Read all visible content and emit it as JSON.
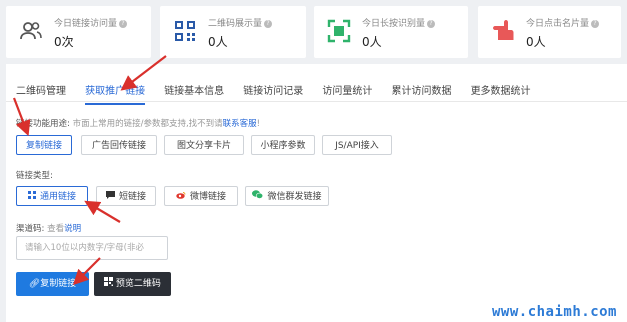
{
  "stats": [
    {
      "label": "今日链接访问量",
      "value": "0次",
      "icon": "users-icon",
      "color": "#555"
    },
    {
      "label": "二维码展示量",
      "value": "0人",
      "icon": "qrcode-icon",
      "color": "#2a5aa8"
    },
    {
      "label": "今日长按识别量",
      "value": "0人",
      "icon": "scan-icon",
      "color": "#2fb36b"
    },
    {
      "label": "今日点击名片量",
      "value": "0人",
      "icon": "hand-icon",
      "color": "#e85858"
    }
  ],
  "tabs": [
    "二维码管理",
    "获取推广链接",
    "链接基本信息",
    "链接访问记录",
    "访问量统计",
    "累计访问数据",
    "更多数据统计"
  ],
  "usage": {
    "label": "链接功能用途:",
    "hint": "市面上常用的链接/参数都支持,找不到请",
    "link": "联系客服",
    "tail": "!",
    "buttons": [
      "复制链接",
      "广告回传链接",
      "图文分享卡片",
      "小程序参数",
      "JS/API接入"
    ]
  },
  "type": {
    "label": "链接类型:",
    "buttons": [
      "通用链接",
      "短链接",
      "微博链接",
      "微信群发链接"
    ]
  },
  "channel": {
    "label": "渠道码:",
    "hint": "查看",
    "link": "说明",
    "placeholder": "请输入10位以内数字/字母(非必"
  },
  "actions": {
    "copy": "复制链接",
    "preview": "预览二维码"
  },
  "watermark": "www.chaimh.com",
  "accent": "#2a6ad6",
  "arrow_color": "#d9302c"
}
